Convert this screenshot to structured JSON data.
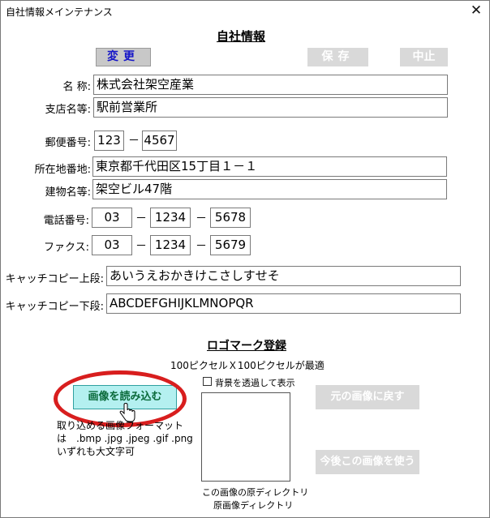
{
  "window": {
    "title": "自社情報メインテナンス",
    "close_symbol": "✕"
  },
  "heading": "自社情報",
  "toolbar": {
    "change": "変更",
    "save": "保存",
    "cancel": "中止"
  },
  "fields": {
    "name": {
      "label": "名  称:",
      "value": "株式会社架空産業"
    },
    "branch": {
      "label": "支店名等:",
      "value": "駅前営業所"
    },
    "postal": {
      "label": "郵便番号:",
      "part1": "123",
      "part2": "4567"
    },
    "address": {
      "label": "所在地番地:",
      "value": "東京都千代田区15丁目１－１"
    },
    "building": {
      "label": "建物名等:",
      "value": "架空ビル47階"
    },
    "phone": {
      "label": "電話番号:",
      "p1": "03",
      "p2": "1234",
      "p3": "5678"
    },
    "fax": {
      "label": "ファクス:",
      "p1": "03",
      "p2": "1234",
      "p3": "5679"
    },
    "catch_upper": {
      "label": "キャッチコピー上段:",
      "value": "あいうえおかきけこさしすせそ"
    },
    "catch_lower": {
      "label": "キャッチコピー下段:",
      "value": "ABCDEFGHIJKLMNOPQR"
    }
  },
  "dash": "－",
  "logo": {
    "heading": "ロゴマーク登録",
    "size_note": "100ピクセルＸ100ピクセルが最適",
    "transparent_label": "背景を透過して表示",
    "load_button": "画像を読み込む",
    "format_line1": "取り込める画像フォーマット",
    "format_line2": "は　.bmp .jpg .jpeg .gif .png",
    "format_line3": "いずれも大文字可",
    "restore_button": "元の画像に戻す",
    "use_button": "今後この画像を使う",
    "orig_dir_label": "この画像の原ディレクトリ",
    "orig_dir_value": "原画像ディレクトリ"
  },
  "colors": {
    "highlight": "#d81e1e",
    "load_button_bg": "#b4f0f0",
    "change_text": "#1414c8"
  }
}
